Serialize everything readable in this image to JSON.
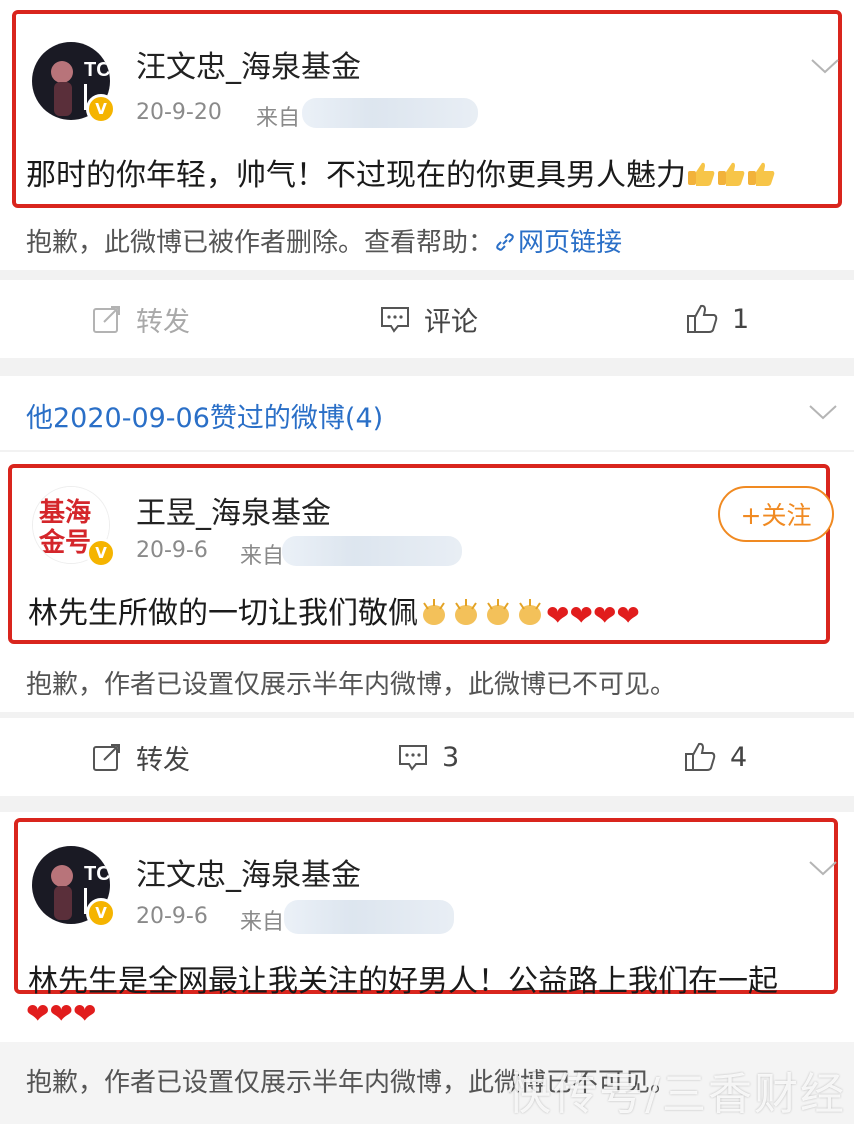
{
  "post1": {
    "username": "汪文忠_海泉基金",
    "date": "20-9-20",
    "source_prefix": "来自",
    "content": "那时的你年轻，帅气！不过现在的你更具男人魅力",
    "emojis": [
      "thumbs-up",
      "thumbs-up",
      "thumbs-up"
    ]
  },
  "notice1": {
    "text": "抱歉，此微博已被作者删除。查看帮助：",
    "link": "网页链接"
  },
  "actions1": {
    "repost": "转发",
    "comment": "评论",
    "likes": "1"
  },
  "section": {
    "title": "他2020-09-06赞过的微博(4)"
  },
  "post2": {
    "username": "王昱_海泉基金",
    "date": "20-9-6",
    "source_prefix": "来自",
    "follow": "+关注",
    "avatar_text": "基海金号",
    "content": "林先生所做的一切让我们敬佩",
    "emojis": [
      "clap",
      "clap",
      "clap",
      "clap",
      "heart",
      "heart",
      "heart",
      "heart"
    ]
  },
  "notice2": {
    "text": "抱歉，作者已设置仅展示半年内微博，此微博已不可见。"
  },
  "actions2": {
    "repost": "转发",
    "comments": "3",
    "likes": "4"
  },
  "post3": {
    "username": "汪文忠_海泉基金",
    "date": "20-9-6",
    "source_prefix": "来自",
    "content": "林先生是全网最让我关注的好男人！公益路上我们在一起",
    "emojis": [
      "heart",
      "heart",
      "heart"
    ]
  },
  "notice3": {
    "text": "抱歉，作者已设置仅展示半年内微博，此微博已不可见。"
  },
  "watermark": "快传号/三香财经",
  "colors": {
    "highlight_border": "#d9251d",
    "link": "#2a6fc7",
    "follow": "#f08a22",
    "verified": "#f5b400",
    "heart": "#e11d1d"
  }
}
